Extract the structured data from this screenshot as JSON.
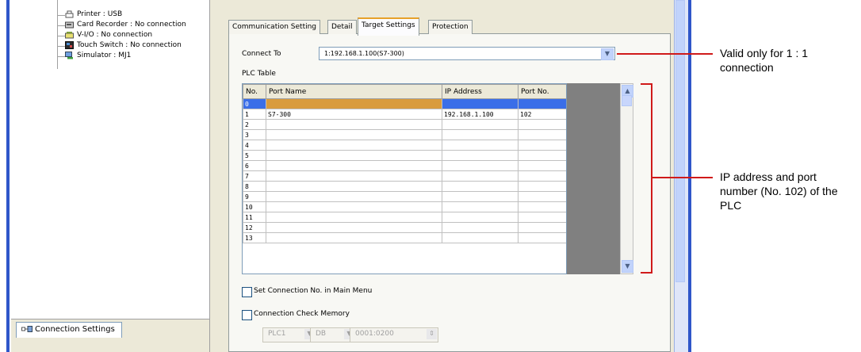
{
  "tree": {
    "items": [
      {
        "label": "Printer : USB",
        "icon": "printer-icon"
      },
      {
        "label": "Card Recorder : No connection",
        "icon": "card-recorder-icon"
      },
      {
        "label": "V-I/O : No connection",
        "icon": "vio-icon"
      },
      {
        "label": "Touch Switch : No connection",
        "icon": "touch-switch-icon"
      },
      {
        "label": "Simulator : MJ1",
        "icon": "simulator-icon"
      }
    ]
  },
  "bottom_tab": {
    "label": "Connection Settings",
    "icon": "connection-settings-icon"
  },
  "tabs": [
    {
      "label": "Communication Setting"
    },
    {
      "label": "Detail"
    },
    {
      "label": "Target Settings"
    },
    {
      "label": "Protection"
    }
  ],
  "connect_to": {
    "label": "Connect To",
    "value": "1:192.168.1.100(S7-300)"
  },
  "plc_table": {
    "title": "PLC Table",
    "headers": {
      "no": "No.",
      "port_name": "Port Name",
      "ip": "IP Address",
      "port_no": "Port No."
    },
    "rows": [
      {
        "no": "0",
        "port_name": "",
        "ip": "",
        "port_no": ""
      },
      {
        "no": "1",
        "port_name": "S7-300",
        "ip": "192.168.1.100",
        "port_no": "102"
      },
      {
        "no": "2",
        "port_name": "",
        "ip": "",
        "port_no": ""
      },
      {
        "no": "3",
        "port_name": "",
        "ip": "",
        "port_no": ""
      },
      {
        "no": "4",
        "port_name": "",
        "ip": "",
        "port_no": ""
      },
      {
        "no": "5",
        "port_name": "",
        "ip": "",
        "port_no": ""
      },
      {
        "no": "6",
        "port_name": "",
        "ip": "",
        "port_no": ""
      },
      {
        "no": "7",
        "port_name": "",
        "ip": "",
        "port_no": ""
      },
      {
        "no": "8",
        "port_name": "",
        "ip": "",
        "port_no": ""
      },
      {
        "no": "9",
        "port_name": "",
        "ip": "",
        "port_no": ""
      },
      {
        "no": "10",
        "port_name": "",
        "ip": "",
        "port_no": ""
      },
      {
        "no": "11",
        "port_name": "",
        "ip": "",
        "port_no": ""
      },
      {
        "no": "12",
        "port_name": "",
        "ip": "",
        "port_no": ""
      },
      {
        "no": "13",
        "port_name": "",
        "ip": "",
        "port_no": ""
      }
    ]
  },
  "options": {
    "set_connection": {
      "label": "Set Connection No. in Main Menu",
      "checked": false
    },
    "check_memory": {
      "label": "Connection Check Memory",
      "checked": false
    },
    "memory_plc": "PLC1",
    "memory_type": "DB",
    "memory_address": "0001:0200"
  },
  "annotations": {
    "connect_note": "Valid only for 1 : 1 connection",
    "table_note": "IP address and port number (No. 102) of the PLC"
  },
  "colors": {
    "selected_row": "#3a6ee8",
    "selected_cell": "#d99b3d",
    "annotation_line": "#d01a1a",
    "active_tab_accent": "#e7a12a"
  }
}
